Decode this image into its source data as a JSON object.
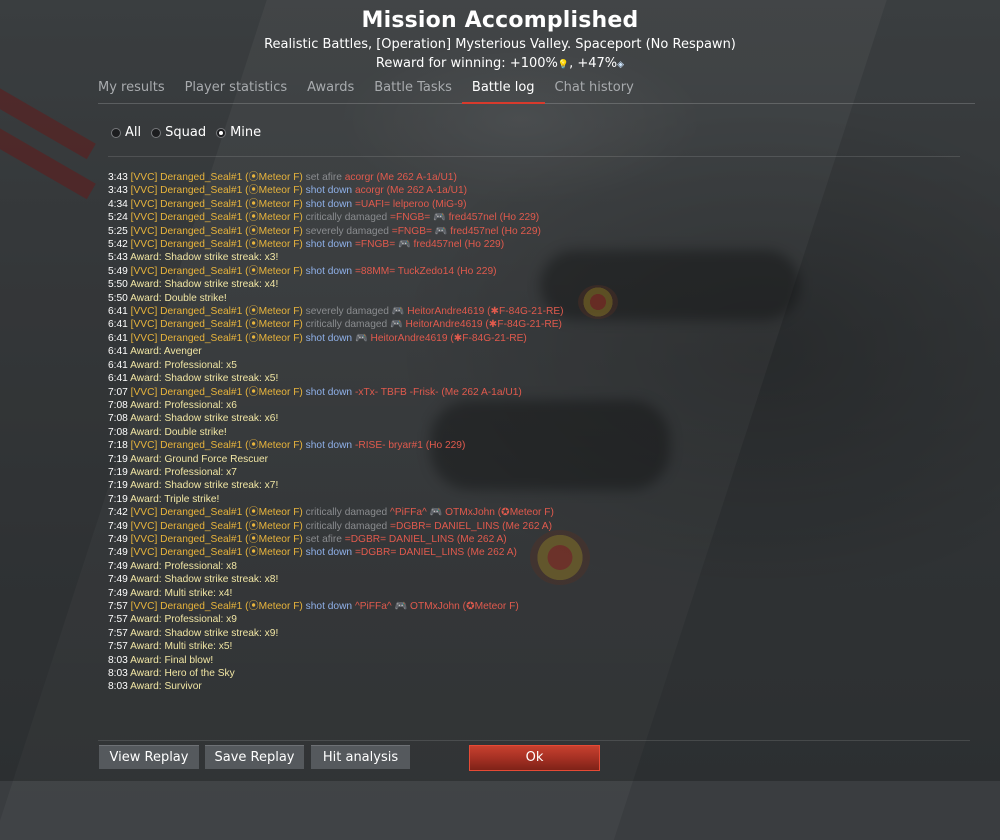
{
  "header": {
    "title": "Mission Accomplished",
    "subtitle": "Realistic Battles, [Operation] Mysterious Valley. Spaceport (No Respawn)",
    "reward_prefix": "Reward for winning: +100%",
    "reward_sep": ", +47%",
    "reward_icon1": "research-bulb-icon",
    "reward_icon2": "silver-lions-icon"
  },
  "tabs": [
    {
      "label": "My results"
    },
    {
      "label": "Player statistics"
    },
    {
      "label": "Awards"
    },
    {
      "label": "Battle Tasks"
    },
    {
      "label": "Battle log",
      "active": true
    },
    {
      "label": "Chat history"
    }
  ],
  "filters": [
    {
      "label": "All",
      "selected": false
    },
    {
      "label": "Squad",
      "selected": false
    },
    {
      "label": "Mine",
      "selected": true
    }
  ],
  "log": [
    {
      "t": "3:43",
      "me": "[VVC] Deranged_Seal#1 (⦿Meteor F)",
      "act": "set afire",
      "act_type": "status",
      "target": "acorgr (Me 262 A-1a/U1)"
    },
    {
      "t": "3:43",
      "me": "[VVC] Deranged_Seal#1 (⦿Meteor F)",
      "act": "shot down",
      "act_type": "kill",
      "target": "acorgr (Me 262 A-1a/U1)"
    },
    {
      "t": "4:34",
      "me": "[VVC] Deranged_Seal#1 (⦿Meteor F)",
      "act": "shot down",
      "act_type": "kill",
      "target": "=UAFI= lelperoo (MiG-9)"
    },
    {
      "t": "5:24",
      "me": "[VVC] Deranged_Seal#1 (⦿Meteor F)",
      "act": "critically damaged",
      "act_type": "status",
      "target": "=FNGB= 🎮 fred457nel (Ho 229)"
    },
    {
      "t": "5:25",
      "me": "[VVC] Deranged_Seal#1 (⦿Meteor F)",
      "act": "severely damaged",
      "act_type": "status",
      "target": "=FNGB= 🎮 fred457nel (Ho 229)"
    },
    {
      "t": "5:42",
      "me": "[VVC] Deranged_Seal#1 (⦿Meteor F)",
      "act": "shot down",
      "act_type": "kill",
      "target": "=FNGB= 🎮 fred457nel (Ho 229)"
    },
    {
      "t": "5:43",
      "award": "Award: Shadow strike streak: x3!"
    },
    {
      "t": "5:49",
      "me": "[VVC] Deranged_Seal#1 (⦿Meteor F)",
      "act": "shot down",
      "act_type": "kill",
      "target": "=88MM= TuckZedo14 (Ho 229)"
    },
    {
      "t": "5:50",
      "award": "Award: Shadow strike streak: x4!"
    },
    {
      "t": "5:50",
      "award": "Award: Double strike!"
    },
    {
      "t": "6:41",
      "me": "[VVC] Deranged_Seal#1 (⦿Meteor F)",
      "act": "severely damaged",
      "act_type": "status",
      "target": "🎮 HeitorAndre4619 (✱F-84G-21-RE)"
    },
    {
      "t": "6:41",
      "me": "[VVC] Deranged_Seal#1 (⦿Meteor F)",
      "act": "critically damaged",
      "act_type": "status",
      "target": "🎮 HeitorAndre4619 (✱F-84G-21-RE)"
    },
    {
      "t": "6:41",
      "me": "[VVC] Deranged_Seal#1 (⦿Meteor F)",
      "act": "shot down",
      "act_type": "kill",
      "target": "🎮 HeitorAndre4619 (✱F-84G-21-RE)"
    },
    {
      "t": "6:41",
      "award": "Award: Avenger"
    },
    {
      "t": "6:41",
      "award": "Award: Professional: x5"
    },
    {
      "t": "6:41",
      "award": "Award: Shadow strike streak: x5!"
    },
    {
      "t": "7:07",
      "me": "[VVC] Deranged_Seal#1 (⦿Meteor F)",
      "act": "shot down",
      "act_type": "kill",
      "target": "-xTx- TBFB -Frisk- (Me 262 A-1a/U1)"
    },
    {
      "t": "7:08",
      "award": "Award: Professional: x6"
    },
    {
      "t": "7:08",
      "award": "Award: Shadow strike streak: x6!"
    },
    {
      "t": "7:08",
      "award": "Award: Double strike!"
    },
    {
      "t": "7:18",
      "me": "[VVC] Deranged_Seal#1 (⦿Meteor F)",
      "act": "shot down",
      "act_type": "kill",
      "target": "-RISE- bryar#1 (Ho 229)"
    },
    {
      "t": "7:19",
      "award": "Award: Ground Force Rescuer"
    },
    {
      "t": "7:19",
      "award": "Award: Professional: x7"
    },
    {
      "t": "7:19",
      "award": "Award: Shadow strike streak: x7!"
    },
    {
      "t": "7:19",
      "award": "Award: Triple strike!"
    },
    {
      "t": "7:42",
      "me": "[VVC] Deranged_Seal#1 (⦿Meteor F)",
      "act": "critically damaged",
      "act_type": "status",
      "target": "^PiFFa^ 🎮 OTMxJohn (✪Meteor F)"
    },
    {
      "t": "7:49",
      "me": "[VVC] Deranged_Seal#1 (⦿Meteor F)",
      "act": "critically damaged",
      "act_type": "status",
      "target": "=DGBR= DANIEL_LINS (Me 262 A)"
    },
    {
      "t": "7:49",
      "me": "[VVC] Deranged_Seal#1 (⦿Meteor F)",
      "act": "set afire",
      "act_type": "status",
      "target": "=DGBR= DANIEL_LINS (Me 262 A)"
    },
    {
      "t": "7:49",
      "me": "[VVC] Deranged_Seal#1 (⦿Meteor F)",
      "act": "shot down",
      "act_type": "kill",
      "target": "=DGBR= DANIEL_LINS (Me 262 A)"
    },
    {
      "t": "7:49",
      "award": "Award: Professional: x8"
    },
    {
      "t": "7:49",
      "award": "Award: Shadow strike streak: x8!"
    },
    {
      "t": "7:49",
      "award": "Award: Multi strike: x4!"
    },
    {
      "t": "7:57",
      "me": "[VVC] Deranged_Seal#1 (⦿Meteor F)",
      "act": "shot down",
      "act_type": "kill",
      "target": "^PiFFa^ 🎮 OTMxJohn (✪Meteor F)"
    },
    {
      "t": "7:57",
      "award": "Award: Professional: x9"
    },
    {
      "t": "7:57",
      "award": "Award: Shadow strike streak: x9!"
    },
    {
      "t": "7:57",
      "award": "Award: Multi strike: x5!"
    },
    {
      "t": "8:03",
      "award": "Award: Final blow!"
    },
    {
      "t": "8:03",
      "award": "Award: Hero of the Sky"
    },
    {
      "t": "8:03",
      "award": "Award: Survivor"
    }
  ],
  "buttons": {
    "view_replay": "View Replay",
    "save_replay": "Save Replay",
    "hit_analysis": "Hit analysis",
    "ok": "Ok"
  },
  "colors": {
    "accent": "#d83a2c",
    "player": "#e8b43c",
    "enemy": "#e05a4d",
    "kill_action": "#8fb0e8",
    "status_action": "#8a8c8f"
  }
}
